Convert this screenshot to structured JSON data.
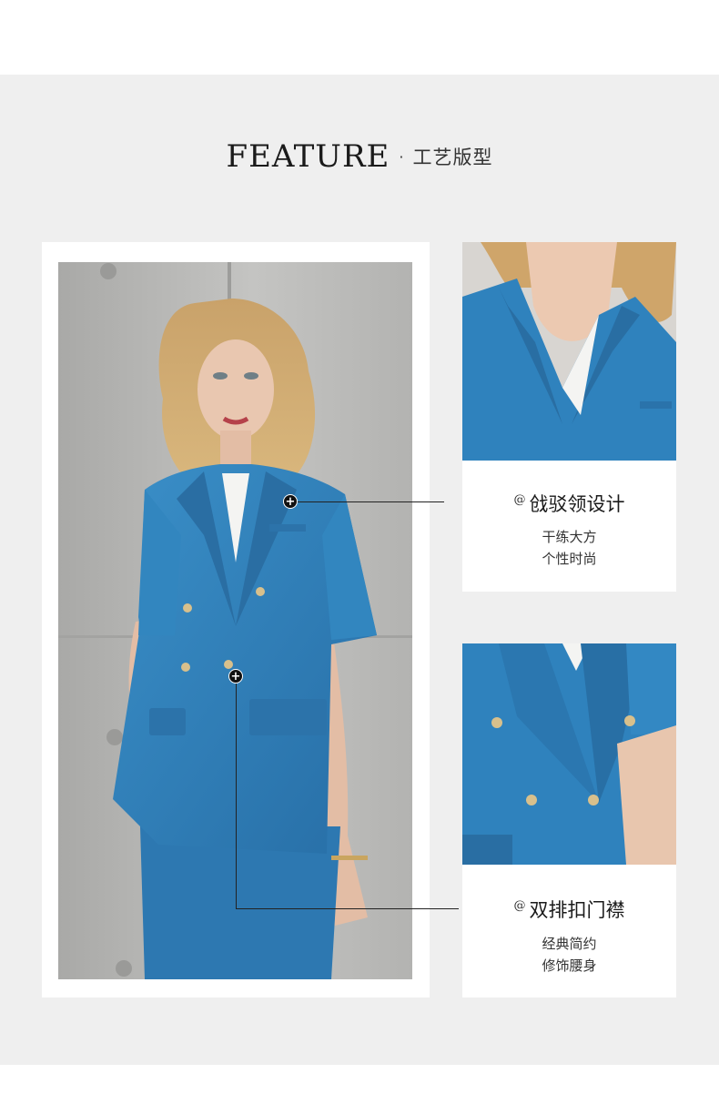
{
  "heading": {
    "en": "FEATURE",
    "separator": "·",
    "cn": "工艺版型"
  },
  "features": [
    {
      "prefix": "@",
      "title": "戗驳领设计",
      "lines": [
        "干练大方",
        "个性时尚"
      ]
    },
    {
      "prefix": "@",
      "title": "双排扣门襟",
      "lines": [
        "经典简约",
        "修饰腰身"
      ]
    }
  ],
  "colors": {
    "background": "#efefef",
    "suit_blue": "#2f7fb8",
    "marker": "#111111"
  },
  "icons": {
    "marker": "plus-icon"
  }
}
